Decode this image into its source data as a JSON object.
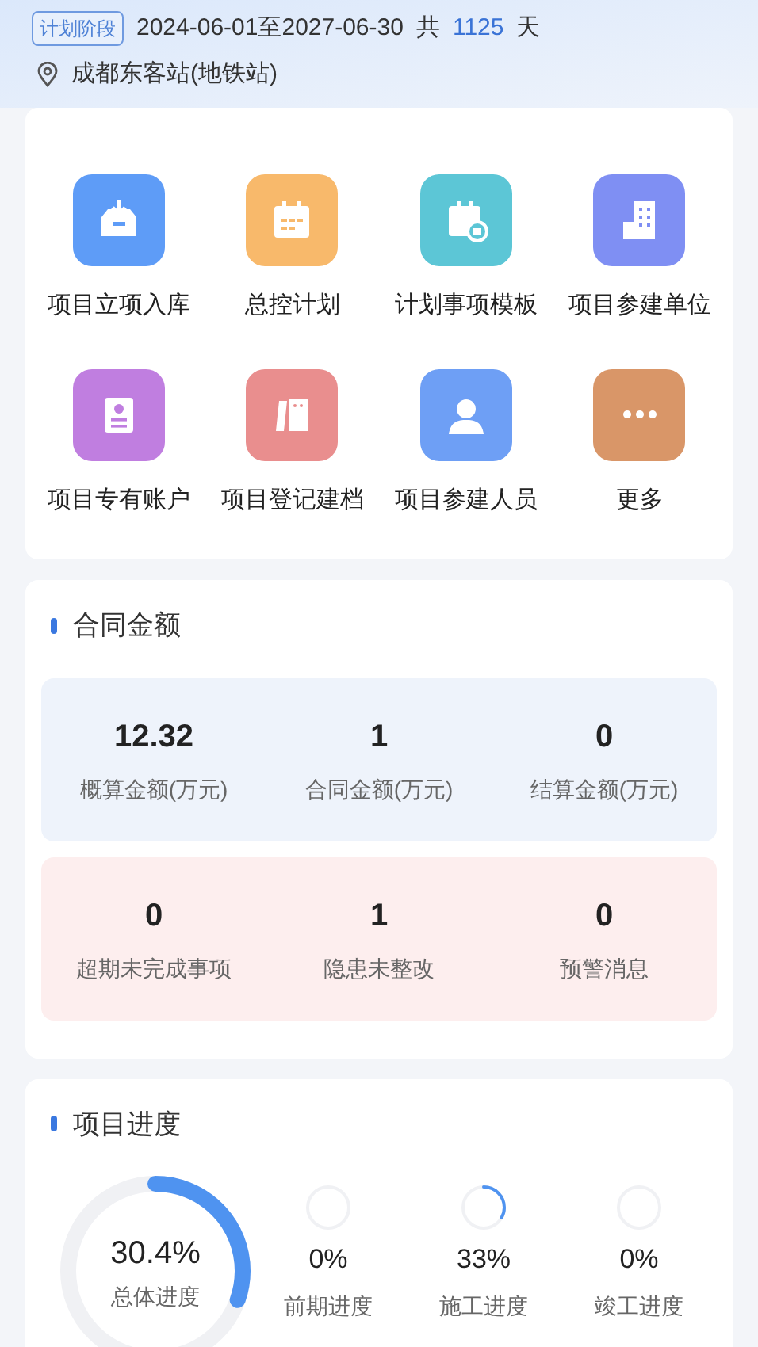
{
  "header": {
    "stage_badge": "计划阶段",
    "date_range": "2024-06-01至2027-06-30",
    "total_prefix": "共",
    "total_days": "1125",
    "total_unit": "天",
    "location": "成都东客站(地铁站)"
  },
  "shortcuts": [
    {
      "label": "项目立项入库",
      "kind": "inbox",
      "color": "#5e9cf7"
    },
    {
      "label": "总控计划",
      "kind": "calendar",
      "color": "#f8b96b"
    },
    {
      "label": "计划事项模板",
      "kind": "calendar-template",
      "color": "#5cc6d6"
    },
    {
      "label": "项目参建单位",
      "kind": "building",
      "color": "#7f8ff3"
    },
    {
      "label": "项目专有账户",
      "kind": "account",
      "color": "#c07ee0"
    },
    {
      "label": "项目登记建档",
      "kind": "files",
      "color": "#e98e8e"
    },
    {
      "label": "项目参建人员",
      "kind": "person",
      "color": "#6e9ff5"
    },
    {
      "label": "更多",
      "kind": "more",
      "color": "#d99668"
    }
  ],
  "contract": {
    "title": "合同金额",
    "amounts": [
      {
        "value": "12.32",
        "label": "概算金额(万元)"
      },
      {
        "value": "1",
        "label": "合同金额(万元)"
      },
      {
        "value": "0",
        "label": "结算金额(万元)"
      }
    ],
    "alerts": [
      {
        "value": "0",
        "label": "超期未完成事项"
      },
      {
        "value": "1",
        "label": "隐患未整改"
      },
      {
        "value": "0",
        "label": "预警消息"
      }
    ]
  },
  "progress": {
    "title": "项目进度",
    "overall": {
      "value": "30.4%",
      "label": "总体进度",
      "level": 0.304
    },
    "stages": [
      {
        "value": "0%",
        "label": "前期进度"
      },
      {
        "value": "33%",
        "label": "施工进度",
        "level": 0.33
      },
      {
        "value": "0%",
        "label": "竣工进度"
      }
    ]
  }
}
